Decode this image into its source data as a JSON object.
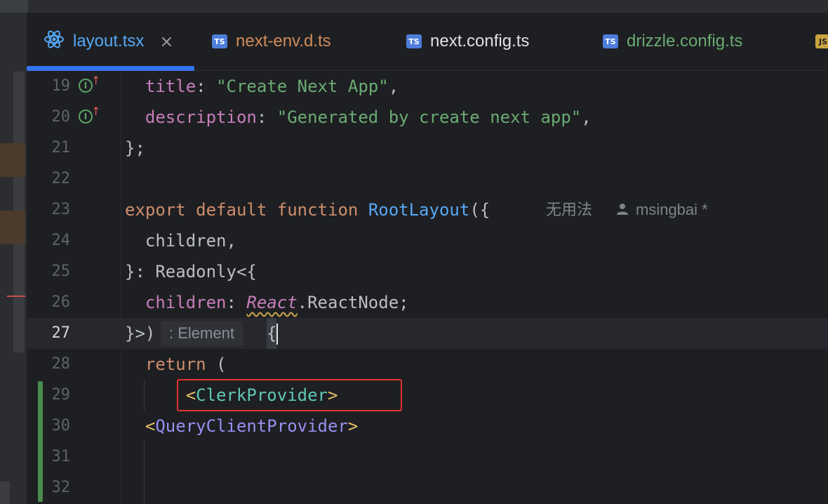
{
  "tabs": [
    {
      "label": "layout.tsx",
      "icon": "react-icon",
      "color": "#56a8f5",
      "active": true
    },
    {
      "label": "next-env.d.ts",
      "icon": "ts-file-icon",
      "color": "#d18a5a",
      "active": false
    },
    {
      "label": "next.config.ts",
      "icon": "ts-file-icon",
      "color": "#dfe1e5",
      "active": false
    },
    {
      "label": "drizzle.config.ts",
      "icon": "ts-file-icon",
      "color": "#6aab73",
      "active": false
    },
    {
      "label": "",
      "icon": "js-file-icon",
      "color": "#c9a441",
      "active": false
    }
  ],
  "icons": {
    "ts": "TS",
    "js": "JS",
    "close": "×",
    "impl": "I",
    "up": "↑"
  },
  "lines": {
    "n19": "19",
    "n20": "20",
    "n21": "21",
    "n22": "22",
    "n23": "23",
    "n24": "24",
    "n25": "25",
    "n26": "26",
    "n27": "27",
    "n28": "28",
    "n29": "29",
    "n30": "30",
    "n31": "31",
    "n32": "32"
  },
  "code": {
    "l19": {
      "key": "title",
      "sep": ": ",
      "val": "\"Create Next App\"",
      "end": ","
    },
    "l20": {
      "key": "description",
      "sep": ": ",
      "val": "\"Generated by create next app\"",
      "end": ","
    },
    "l21": "};",
    "l23": {
      "kw1": "export",
      "kw2": "default",
      "kw3": "function",
      "fn": "RootLayout",
      "rest": "({"
    },
    "l24": "children,",
    "l25": "}: Readonly<{",
    "l26": {
      "key": "children",
      "sep": ": ",
      "ns": "React",
      "type": ".ReactNode;"
    },
    "l27": {
      "code": "}>)",
      "hint": ": Element",
      "brace": "{"
    },
    "l28": {
      "kw": "return",
      "rest": " ("
    },
    "l29": {
      "open": "<",
      "tag": "ClerkProvider",
      "close": ">"
    },
    "l30": {
      "open": "<",
      "tag": "QueryClientProvider",
      "close": ">"
    }
  },
  "inlay": {
    "usages": "无用法",
    "author": "msingbai *"
  }
}
